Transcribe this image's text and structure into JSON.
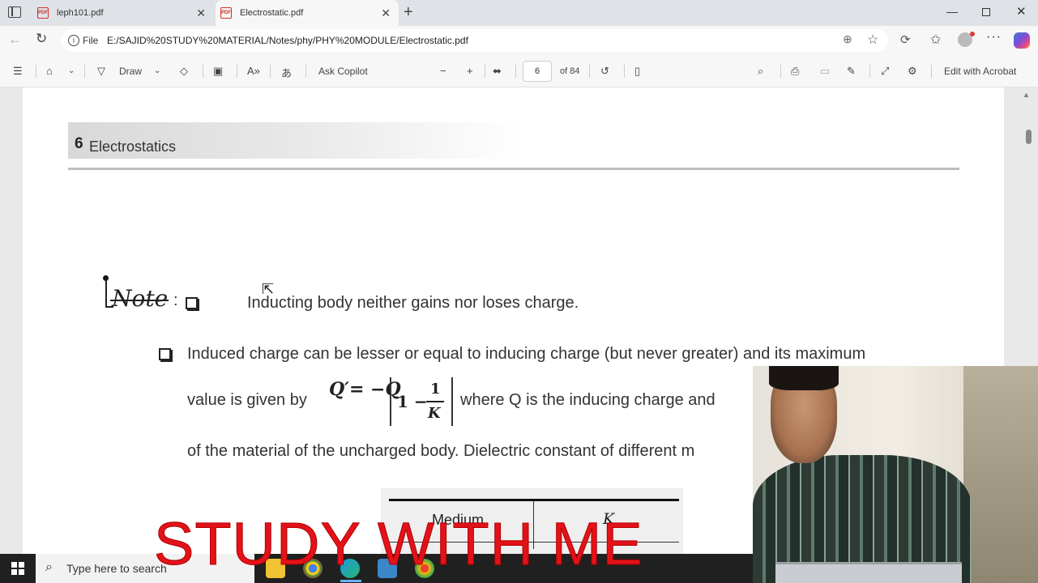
{
  "browser": {
    "tabs": [
      {
        "label": "leph101.pdf"
      },
      {
        "label": "Electrostatic.pdf"
      }
    ],
    "address": {
      "scheme_label": "File",
      "url": "E:/SAJID%20STUDY%20MATERIAL/Notes/phy/PHY%20MODULE/Electrostatic.pdf"
    }
  },
  "pdf_toolbar": {
    "draw_label": "Draw",
    "ask_copilot_label": "Ask Copilot",
    "page_current": "6",
    "page_total": "of 84",
    "edit_acrobat_label": "Edit with Acrobat"
  },
  "document": {
    "chapter_number": "6",
    "chapter_title": "Electrostatics",
    "note_label": "Note",
    "note_colon": ":",
    "line1": "Inducting body neither gains nor loses charge.",
    "line2": "Induced charge can be lesser or equal to inducing charge (but never greater) and its maximum",
    "line3_prefix": "value is given by",
    "formula_left": "Q′= −Q",
    "formula_one_minus": "1 −",
    "formula_num": "1",
    "formula_den": "K",
    "line3_suffix": "where Q is the inducing charge and",
    "line4": "of the material of the uncharged body. Dielectric constant of different m",
    "table": {
      "col1": "Medium",
      "col2": "K"
    }
  },
  "taskbar": {
    "search_placeholder": "Type here to search"
  },
  "overlay": {
    "title": "STUDY WITH ME"
  }
}
